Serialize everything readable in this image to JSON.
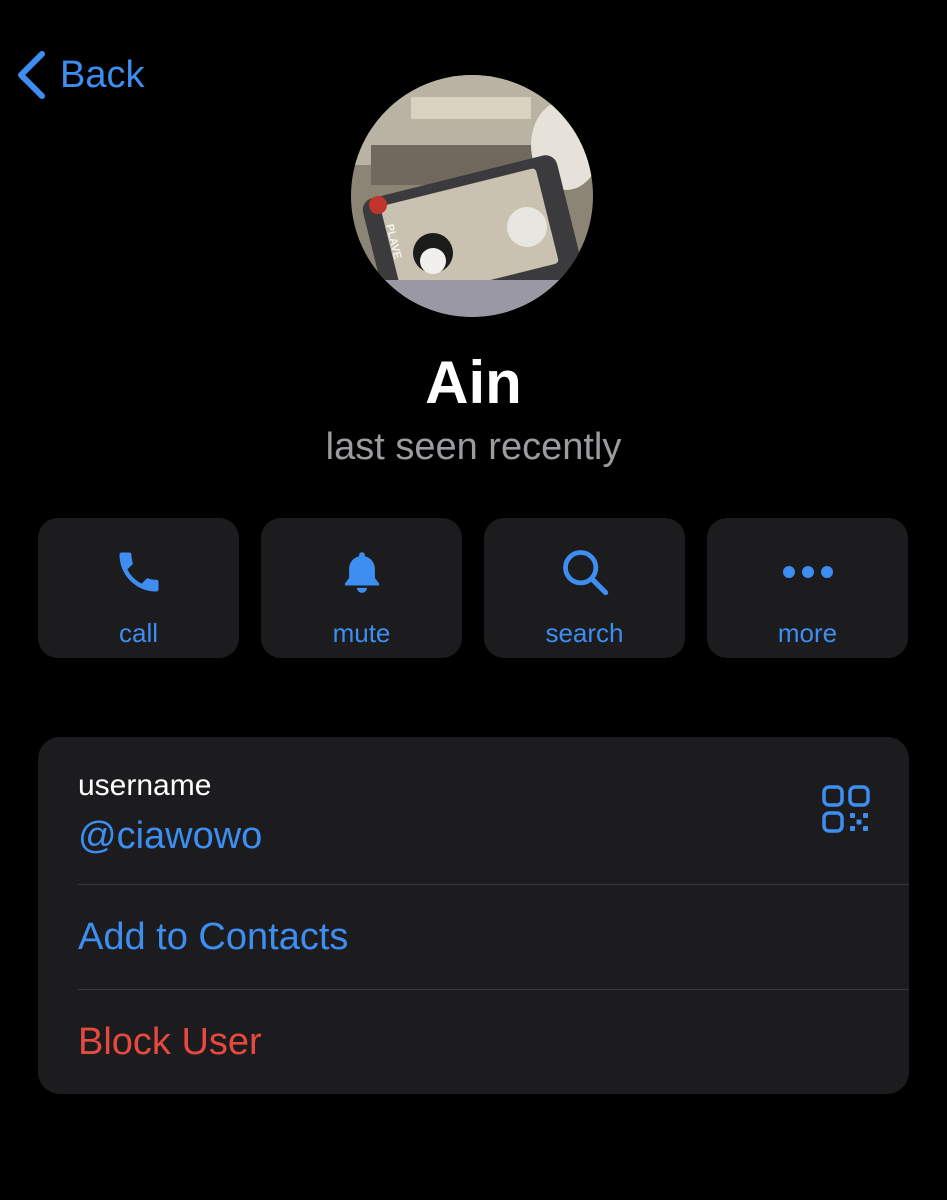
{
  "nav": {
    "back_label": "Back",
    "back_icon": "chevron-left-icon"
  },
  "profile": {
    "name": "Ain",
    "status": "last seen recently",
    "avatar_text": "PLAVE"
  },
  "actions": [
    {
      "label": "call",
      "icon": "phone-icon"
    },
    {
      "label": "mute",
      "icon": "bell-icon"
    },
    {
      "label": "search",
      "icon": "search-icon"
    },
    {
      "label": "more",
      "icon": "more-dots-icon"
    }
  ],
  "info": {
    "username_caption": "username",
    "username_value": "@ciawowo",
    "qr_icon": "qr-code-icon",
    "add_contact_label": "Add to Contacts",
    "block_label": "Block User"
  },
  "colors": {
    "background": "#000000",
    "card": "#1c1c1e",
    "accent": "#3d8ef0",
    "destructive": "#e5493f",
    "secondary_text": "#9b9ba0"
  }
}
